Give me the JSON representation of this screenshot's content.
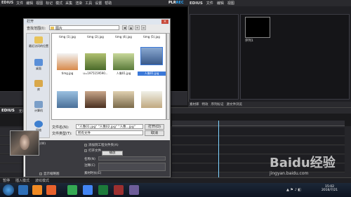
{
  "menubar": {
    "app": "EDIUS",
    "items": [
      "文件",
      "编辑",
      "视图",
      "标记",
      "模式",
      "采集",
      "渲染",
      "工具",
      "设置",
      "帮助"
    ],
    "badge_left": "PLR",
    "badge_right": "REC"
  },
  "right_menu": {
    "app": "EDIUS",
    "items": [
      "文件",
      "编辑",
      "视图"
    ]
  },
  "bin": {
    "clip_label": "序列1"
  },
  "bin_tabs": [
    "素材库",
    "特效",
    "序列标记",
    "源文件浏览"
  ],
  "timeline_header": {
    "app": "EDIUS",
    "label": "无标题"
  },
  "status": {
    "left": "暂停",
    "middle": "插入模式",
    "right": "波纹模式"
  },
  "dialog": {
    "title": "打开",
    "lookin_label": "查找范围(I):",
    "lookin_value": "图片",
    "places": [
      "最近访问的位置",
      "桌面",
      "库",
      "计算机",
      "网络"
    ],
    "files": [
      {
        "name": "timg (1).jpg"
      },
      {
        "name": "timg (2).jpg"
      },
      {
        "name": "timg (4).jpg"
      },
      {
        "name": "timg (5).jpg"
      },
      {
        "name": "timg.jpg"
      },
      {
        "name": "u=1975159590..."
      },
      {
        "name": "人像01.jpg"
      },
      {
        "name": "人像01.jpg"
      }
    ],
    "filename_label": "文件名(N):",
    "filename_value": "\"人像01.jpg\" \"人像02.jpg\" \"人像...jpg\"",
    "filetype_label": "文件类型(T):",
    "filetype_value": "所有文件",
    "open_button": "打开(O)",
    "cancel_button": "取消",
    "preview_label": "预览(W)",
    "chk1": "添加到工程文件夹(A)",
    "chk2": "打开文件",
    "name_label": "名称(N)",
    "comment_label": "注释(C)",
    "seq_label": "素材时长(E)",
    "play_button": "播放",
    "chk3": "显示缩略图"
  },
  "taskbar": {
    "time": "15:02",
    "date": "2016/7/21"
  },
  "watermark": {
    "big": "Baidu经验",
    "small": "jingyan.baidu.com"
  }
}
